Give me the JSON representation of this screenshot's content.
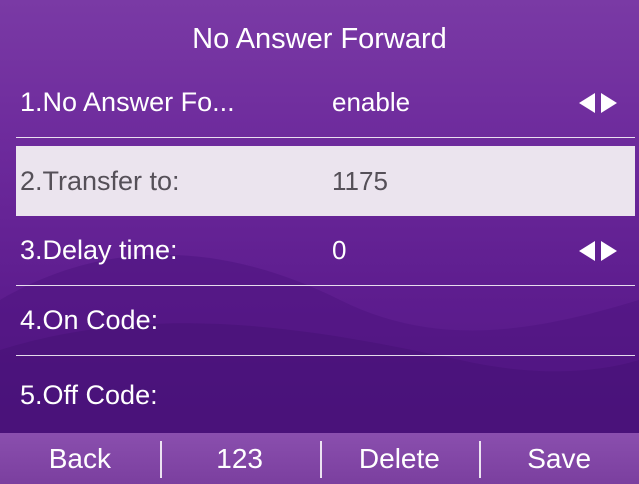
{
  "screen": {
    "title": "No Answer Forward"
  },
  "rows": [
    {
      "label": "1.No Answer Fo...",
      "value": "enable",
      "icon": "left-right-arrows-icon"
    },
    {
      "label": "2.Transfer to:",
      "value": "1175"
    },
    {
      "label": "3.Delay time:",
      "value": "0",
      "icon": "left-right-arrows-icon"
    },
    {
      "label": "4.On Code:",
      "value": ""
    },
    {
      "label": "5.Off Code:",
      "value": ""
    }
  ],
  "softkeys": [
    "Back",
    "123",
    "Delete",
    "Save"
  ],
  "colors": {
    "background": "#6d2a9c",
    "selected_row": "#ebe4ee",
    "text": "#ffffff",
    "selected_text": "#555058"
  }
}
